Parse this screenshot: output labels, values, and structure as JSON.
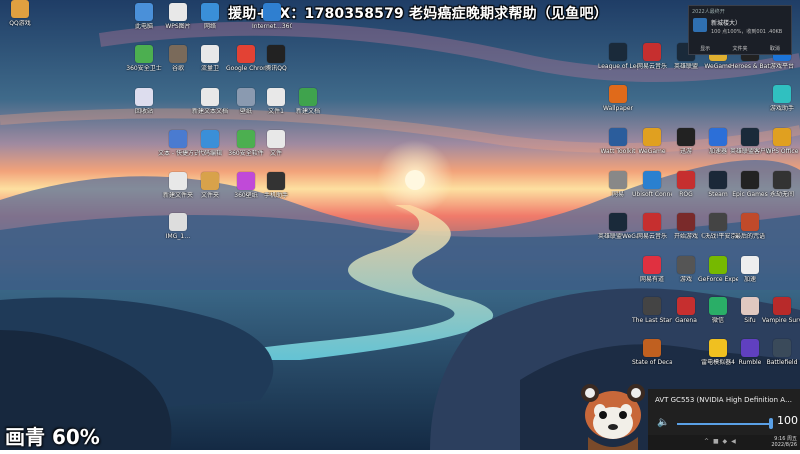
{
  "overlay": {
    "banner": "援助+VX：1780358579 老妈癌症晚期求帮助（见鱼吧）",
    "quality": "画青 60%"
  },
  "notification": {
    "header": "2022人最终开",
    "title": "新城楼大）",
    "text": "100 点100%，收到001 .40KB",
    "actions": [
      "显示",
      "文件夹",
      "取消"
    ]
  },
  "desktop_left": [
    {
      "label": "此电脑",
      "icon": "computer-icon",
      "color": "#4a90d9"
    },
    {
      "label": "WPS图片",
      "icon": "file-icon",
      "color": "#e8e8e8"
    },
    {
      "label": "网络",
      "icon": "network-icon",
      "color": "#3a8fd8"
    },
    {
      "label": "Internet…360安全卫",
      "icon": "ie-icon",
      "color": "#2f7fd0"
    },
    {
      "label": "360安全卫士",
      "icon": "shield-icon",
      "color": "#4caf50"
    },
    {
      "label": "谷歌",
      "icon": "app-icon",
      "color": "#7a6a5a"
    },
    {
      "label": "流量卫",
      "icon": "file-icon",
      "color": "#e8e8e8"
    },
    {
      "label": "Google Chrome",
      "icon": "chrome-icon",
      "color": "#e34234"
    },
    {
      "label": "腾讯QQ",
      "icon": "qq-icon",
      "color": "#222"
    },
    {
      "label": "回收站",
      "icon": "recycle-bin-icon",
      "color": "#dde"
    },
    {
      "label": "新建文本文档",
      "icon": "file-icon",
      "color": "#e8e8e8"
    },
    {
      "label": "壁纸",
      "icon": "image-icon",
      "color": "#8a9ab0"
    },
    {
      "label": "文件1",
      "icon": "file-icon",
      "color": "#e8e8e8"
    },
    {
      "label": "新建文档",
      "icon": "doc-icon",
      "color": "#3fa34d"
    },
    {
      "label": "文本 - 快捷方式",
      "icon": "doc-icon",
      "color": "#4a7bd0"
    },
    {
      "label": "代码编辑",
      "icon": "app-icon",
      "color": "#3a8fd8"
    },
    {
      "label": "360安全软件",
      "icon": "app-icon",
      "color": "#4caf50"
    },
    {
      "label": "文件",
      "icon": "file-icon",
      "color": "#e8e8e8"
    },
    {
      "label": "新建文件夹",
      "icon": "file-icon",
      "color": "#e8e8e8"
    },
    {
      "label": "文件夹",
      "icon": "folder-icon",
      "color": "#d8a24a"
    },
    {
      "label": "360壁纸",
      "icon": "app-icon",
      "color": "#c04ad8"
    },
    {
      "label": "手机助手",
      "icon": "phone-icon",
      "color": "#333"
    },
    {
      "label": "IMG_1…",
      "icon": "phone-file-icon",
      "color": "#ddd"
    }
  ],
  "desktop_right": [
    {
      "label": "League of Legends",
      "icon": "lol-icon",
      "color": "#1a2a3a"
    },
    {
      "label": "网易云音乐",
      "icon": "app-icon",
      "color": "#c62f2f"
    },
    {
      "label": "英雄联盟",
      "icon": "lol-icon",
      "color": "#1a2a3a"
    },
    {
      "label": "WeGame",
      "icon": "app-icon",
      "color": "#e0b030"
    },
    {
      "label": "Heroes & Battles",
      "icon": "app-icon",
      "color": "#222"
    },
    {
      "label": "游戏平台",
      "icon": "app-icon",
      "color": "#1c74d8"
    },
    {
      "label": "Wallpaper",
      "icon": "app-icon",
      "color": "#e06a1a"
    },
    {
      "label": "游戏助手",
      "icon": "app-icon",
      "color": "#30c0c0"
    },
    {
      "label": "Watt Toolkit",
      "icon": "app-icon",
      "color": "#2b5d9c"
    },
    {
      "label": "WeGame",
      "icon": "app-icon",
      "color": "#e0a020"
    },
    {
      "label": "迅游",
      "icon": "app-icon",
      "color": "#222"
    },
    {
      "label": "加速器",
      "icon": "app-icon",
      "color": "#2c6fd8"
    },
    {
      "label": "英雄联盟客户端",
      "icon": "lol-icon",
      "color": "#1a2a3a"
    },
    {
      "label": "WPS Office",
      "icon": "app-icon",
      "color": "#e0a020"
    },
    {
      "label": "网易",
      "icon": "app-icon",
      "color": "#888"
    },
    {
      "label": "Ubisoft Connect",
      "icon": "app-icon",
      "color": "#2a80d0"
    },
    {
      "label": "ROG",
      "icon": "app-icon",
      "color": "#c62f2f"
    },
    {
      "label": "Steam",
      "icon": "steam-icon",
      "color": "#1b2838"
    },
    {
      "label": "Epic Games",
      "icon": "epic-icon",
      "color": "#222"
    },
    {
      "label": "永劫无间",
      "icon": "app-icon",
      "color": "#333"
    },
    {
      "label": "英雄联盟WeGame",
      "icon": "lol-icon",
      "color": "#1a2a3a"
    },
    {
      "label": "网易云音乐",
      "icon": "app-icon",
      "color": "#c62f2f"
    },
    {
      "label": "开始游戏",
      "icon": "app-icon",
      "color": "#7a2a2a"
    },
    {
      "label": "《决战!平安京》",
      "icon": "app-icon",
      "color": "#444"
    },
    {
      "label": "最后的咒语",
      "icon": "app-icon",
      "color": "#c04a2a"
    },
    {
      "label": "网易有道",
      "icon": "app-icon",
      "color": "#e03040"
    },
    {
      "label": "游戏",
      "icon": "app-icon",
      "color": "#555"
    },
    {
      "label": "GeForce Experience",
      "icon": "nvidia-icon",
      "color": "#76b900"
    },
    {
      "label": "加速",
      "icon": "gauge-icon",
      "color": "#eee"
    },
    {
      "label": "The Last Stand",
      "icon": "app-icon",
      "color": "#444"
    },
    {
      "label": "Garena",
      "icon": "app-icon",
      "color": "#c62f2f"
    },
    {
      "label": "微信",
      "icon": "wechat-icon",
      "color": "#2aae67"
    },
    {
      "label": "Sifu",
      "icon": "app-icon",
      "color": "#e0c8c0"
    },
    {
      "label": "Vampire Survivors",
      "icon": "app-icon",
      "color": "#b82a2a"
    },
    {
      "label": "State of Decay 2",
      "icon": "app-icon",
      "color": "#c06020"
    },
    {
      "label": "雷电模拟器4",
      "icon": "app-icon",
      "color": "#f0c020"
    },
    {
      "label": "Rumble",
      "icon": "app-icon",
      "color": "#6040c0"
    },
    {
      "label": "Battlefield",
      "icon": "app-icon",
      "color": "#3a4a5a"
    },
    {
      "label": "QQ游戏",
      "icon": "app-icon",
      "color": "#e0a040"
    }
  ],
  "audio": {
    "device": "AVT GC553 (NVIDIA High Definition A…",
    "volume": "100",
    "volume_level": 1.0
  },
  "taskbar": {
    "time": "9:16 周五",
    "date": "2022/8/26"
  },
  "webcam": {
    "icon": "red-panda-avatar"
  }
}
